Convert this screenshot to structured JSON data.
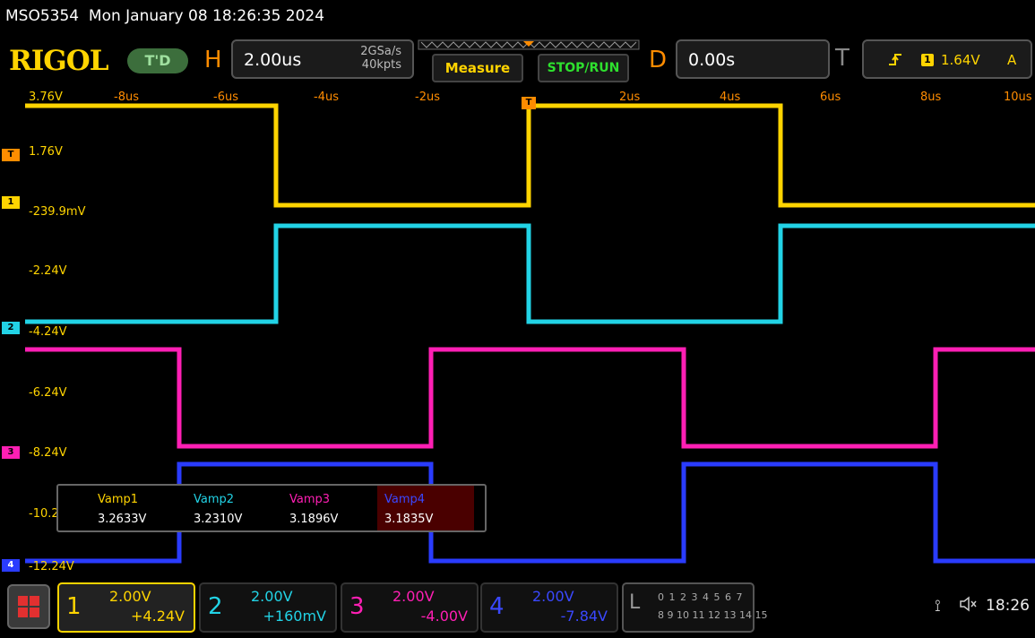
{
  "header": {
    "title": "MSO5354  Mon January 08 18:26:35 2024"
  },
  "topbar": {
    "logo": "RIGOL",
    "trigger_status": "T'D",
    "horizontal": {
      "letter": "H",
      "timebase": "2.00us",
      "sample_rate": "2GSa/s",
      "memory_depth": "40kpts"
    },
    "measure_label": "Measure",
    "stop_run_label": "STOP/RUN",
    "delay": {
      "letter": "D",
      "value": "0.00s"
    },
    "trigger": {
      "letter": "T",
      "slope_icon": "rising-edge-icon",
      "source": "1",
      "level": "1.64V",
      "mode": "A"
    }
  },
  "time_axis": [
    "-8us",
    "-6us",
    "-4us",
    "-2us",
    "2us",
    "4us",
    "6us",
    "8us",
    "10us"
  ],
  "volt_axis": [
    "3.76V",
    "1.76V",
    "-239.9mV",
    "-2.24V",
    "-4.24V",
    "-6.24V",
    "-8.24V",
    "-10.2",
    "-12.24V"
  ],
  "markers": {
    "trigger": "T",
    "ch1": "1",
    "ch2": "2",
    "ch3": "3",
    "ch4": "4",
    "time_trigger": "T"
  },
  "measurements": [
    {
      "name": "Vamp1",
      "value": "3.2633V",
      "color": "#ffd400"
    },
    {
      "name": "Vamp2",
      "value": "3.2310V",
      "color": "#22d3e6"
    },
    {
      "name": "Vamp3",
      "value": "3.1896V",
      "color": "#ff1fb4"
    },
    {
      "name": "Vamp4",
      "value": "3.1835V",
      "color": "#2a3cff"
    }
  ],
  "channels": [
    {
      "num": "1",
      "scale": "2.00V",
      "offset": "+4.24V",
      "color": "#ffd400"
    },
    {
      "num": "2",
      "scale": "2.00V",
      "offset": "+160mV",
      "color": "#22d3e6"
    },
    {
      "num": "3",
      "scale": "2.00V",
      "offset": "-4.00V",
      "color": "#ff1fb4"
    },
    {
      "num": "4",
      "scale": "2.00V",
      "offset": "-7.84V",
      "color": "#2a3cff"
    }
  ],
  "la": {
    "letter": "L",
    "row1": "0 1 2 3  4 5 6 7",
    "row2": "8 9 10 11 12 13 14 15"
  },
  "status": {
    "usb_icon": "usb-icon",
    "speaker_icon": "speaker-muted-icon",
    "clock": "18:26"
  },
  "colors": {
    "ch1": "#ffd400",
    "ch2": "#22d3e6",
    "ch3": "#ff1fb4",
    "ch4": "#2a3cff",
    "accent": "#ff8c00"
  }
}
